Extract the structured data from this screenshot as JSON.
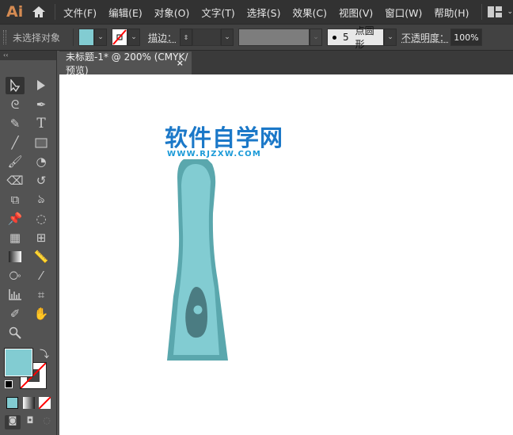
{
  "app": {
    "logo": "Ai"
  },
  "menu": [
    "文件(F)",
    "编辑(E)",
    "对象(O)",
    "文字(T)",
    "选择(S)",
    "效果(C)",
    "视图(V)",
    "窗口(W)",
    "帮助(H)"
  ],
  "control": {
    "selection": "未选择对象",
    "stroke_label": "描边：",
    "brush_size": "5",
    "brush_label": "点圆形",
    "opacity_label": "不透明度：",
    "opacity": "100%"
  },
  "colors": {
    "fill": "#82ccd2",
    "stroke": "none",
    "handle_dark": "#5aa7ad",
    "handle_light": "#82ccd2",
    "button": "#4b7c82",
    "logo_blue": "#1b78c8"
  },
  "document": {
    "tab_title": "未标题-1* @ 200% (CMYK/预览)",
    "close": "×"
  },
  "watermark": {
    "title": "软件自学网",
    "url": "WWW.RJZXW.COM"
  },
  "toolbar": {
    "collapse": "‹‹"
  }
}
